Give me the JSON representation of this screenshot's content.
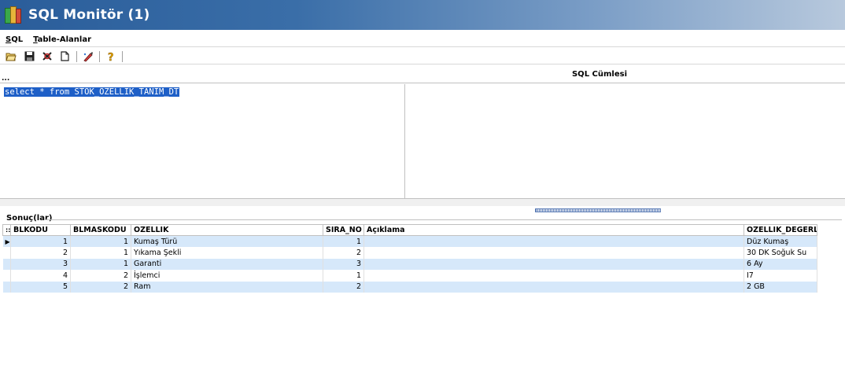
{
  "window": {
    "title": "SQL Monitör (1)"
  },
  "menu": {
    "items": [
      "SQL",
      "Table-Alanlar"
    ]
  },
  "toolbar": {
    "buttons": [
      {
        "name": "open-icon",
        "glyph": "📂"
      },
      {
        "name": "save-icon",
        "glyph": "💾"
      },
      {
        "name": "execute-icon",
        "glyph": "✖"
      },
      {
        "name": "new-icon",
        "glyph": "🗋"
      },
      {
        "name": "edit-icon",
        "glyph": "✎"
      },
      {
        "name": "help-icon",
        "glyph": "?"
      }
    ]
  },
  "panes": {
    "ellipsis": "...",
    "sql_header": "SQL Cümlesi",
    "sql_text": "select * from STOK_OZELLIK_TANIM_DT"
  },
  "results": {
    "label": "Sonuç(lar)",
    "indicator_header": "::",
    "columns": [
      "BLKODU",
      "BLMASKODU",
      "OZELLIK",
      "SIRA_NO",
      "Açıklama",
      "OZELLIK_DEGERLERI"
    ],
    "rows": [
      {
        "current": true,
        "blkodu": "1",
        "blmaskodu": "1",
        "ozellik": "Kumaş Türü",
        "sira_no": "1",
        "aciklama": "",
        "degerler": "Düz Kumaş"
      },
      {
        "current": false,
        "blkodu": "2",
        "blmaskodu": "1",
        "ozellik": "Yıkama Şekli",
        "sira_no": "2",
        "aciklama": "",
        "degerler": "30 DK Soğuk Su"
      },
      {
        "current": false,
        "blkodu": "3",
        "blmaskodu": "1",
        "ozellik": "Garanti",
        "sira_no": "3",
        "aciklama": "",
        "degerler": "6 Ay"
      },
      {
        "current": false,
        "blkodu": "4",
        "blmaskodu": "2",
        "ozellik": "İşlemci",
        "sira_no": "1",
        "aciklama": "",
        "degerler": "I7"
      },
      {
        "current": false,
        "blkodu": "5",
        "blmaskodu": "2",
        "ozellik": "Ram",
        "sira_no": "2",
        "aciklama": "",
        "degerler": "2 GB"
      }
    ]
  }
}
